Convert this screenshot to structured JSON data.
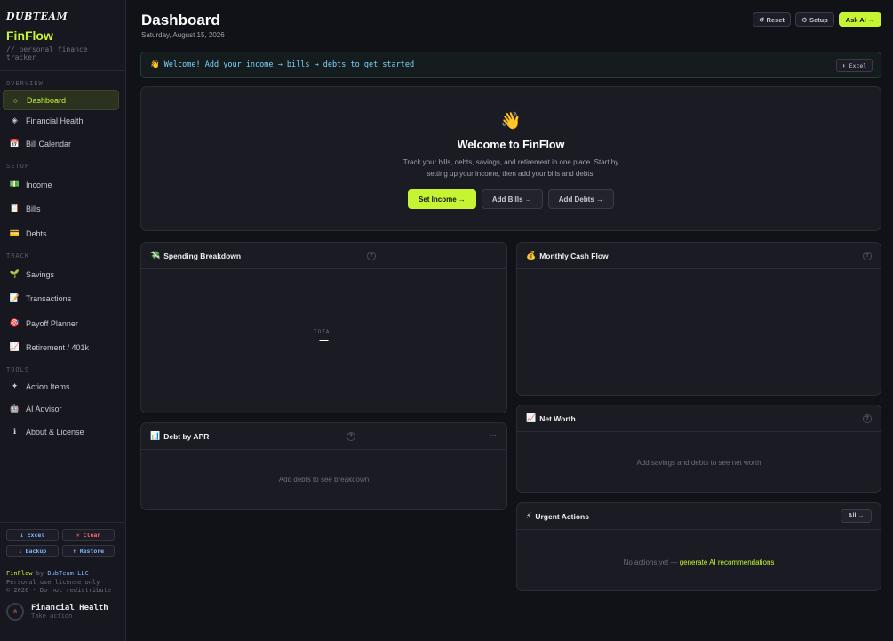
{
  "brand": {
    "logo": "DUBTEAM",
    "name": "FinFlow",
    "tagline_1": "// personal finance",
    "tagline_2": "tracker"
  },
  "sidebar": {
    "sections": [
      "OVERVIEW",
      "SETUP",
      "TRACK",
      "TOOLS"
    ],
    "items": [
      {
        "label": "Dashboard",
        "icon": "○"
      },
      {
        "label": "Financial Health",
        "icon": "◈"
      },
      {
        "label": "Bill Calendar",
        "icon": "📅"
      },
      {
        "label": "Income",
        "icon": "💵"
      },
      {
        "label": "Bills",
        "icon": "📋"
      },
      {
        "label": "Debts",
        "icon": "💳"
      },
      {
        "label": "Savings",
        "icon": "🌱"
      },
      {
        "label": "Transactions",
        "icon": "📝"
      },
      {
        "label": "Payoff Planner",
        "icon": "🎯"
      },
      {
        "label": "Retirement / 401k",
        "icon": "📈"
      },
      {
        "label": "Action Items",
        "icon": "✦"
      },
      {
        "label": "AI Advisor",
        "icon": "🤖"
      },
      {
        "label": "About & License",
        "icon": "ℹ"
      }
    ],
    "buttons": {
      "excel": "↓ Excel",
      "clear": "✕ Clear",
      "backup": "↓ Backup",
      "restore": "↑ Restore"
    },
    "license": {
      "product": "FinFlow",
      "by": " by ",
      "company": "DubTeam LLC",
      "line2": "Personal use license only",
      "line3": "© 2026 · Do not redistribute"
    },
    "health": {
      "score": "0",
      "title": "Financial Health",
      "subtitle": "Take action"
    }
  },
  "header": {
    "title": "Dashboard",
    "date": "Saturday, August 15, 2026",
    "reset": "↺ Reset",
    "setup": "⚙ Setup",
    "ask_ai": "Ask AI →"
  },
  "banner": {
    "text": "👋 Welcome! Add your income → bills → debts to get started",
    "excel": "⬇ Excel"
  },
  "hero": {
    "emoji": "👋",
    "title": "Welcome to FinFlow",
    "desc": "Track your bills, debts, savings, and retirement in one place. Start by setting up your income, then add your bills and debts.",
    "btn_income": "Set Income →",
    "btn_bills": "Add Bills →",
    "btn_debts": "Add Debts →"
  },
  "cards": {
    "spending": {
      "icon": "💸",
      "title": "Spending Breakdown",
      "total_label": "TOTAL",
      "total_value": "—"
    },
    "cashflow": {
      "icon": "💰",
      "title": "Monthly Cash Flow"
    },
    "debt_apr": {
      "icon": "📊",
      "title": "Debt by APR",
      "empty": "Add debts to see breakdown",
      "more": "···"
    },
    "net_worth": {
      "icon": "📈",
      "title": "Net Worth",
      "empty": "Add savings and debts to see net worth"
    },
    "urgent": {
      "icon": "⚡",
      "title": "Urgent Actions",
      "all": "All →",
      "empty": "No actions yet — ",
      "link": "generate AI recommendations"
    }
  },
  "help_glyph": "?"
}
